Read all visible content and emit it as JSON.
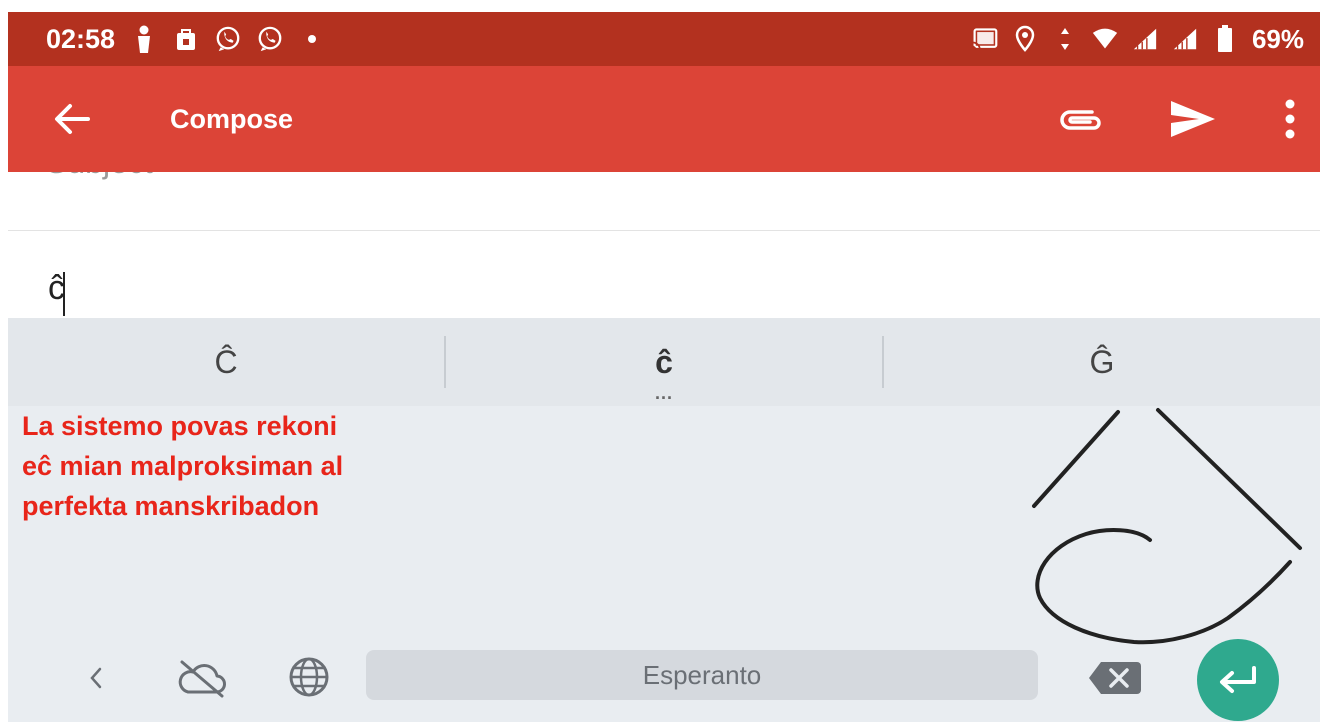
{
  "status_bar": {
    "time": "02:58",
    "battery_percent": "69%",
    "left_icons": [
      "person-icon",
      "bag-icon",
      "viber-icon",
      "viber-icon",
      "dot-icon"
    ],
    "right_icons": [
      "cast-icon",
      "location-icon",
      "data-arrows-icon",
      "wifi-icon",
      "signal-icon",
      "signal-icon",
      "battery-icon"
    ]
  },
  "app_bar": {
    "title": "Compose",
    "color": "#dc4437"
  },
  "compose": {
    "subject_placeholder": "Subject",
    "body_text": "ĉ"
  },
  "suggestions": {
    "items": [
      "Ĉ",
      "ĉ",
      "Ĝ"
    ],
    "more": "..."
  },
  "annotation": {
    "lines": [
      "La sistemo povas rekoni",
      "eĉ mian malproksiman al",
      "perfekta manskribadon"
    ],
    "color": "#e8251a"
  },
  "keyboard": {
    "space_label": "Esperanto",
    "enter_color": "#2fa98e"
  }
}
